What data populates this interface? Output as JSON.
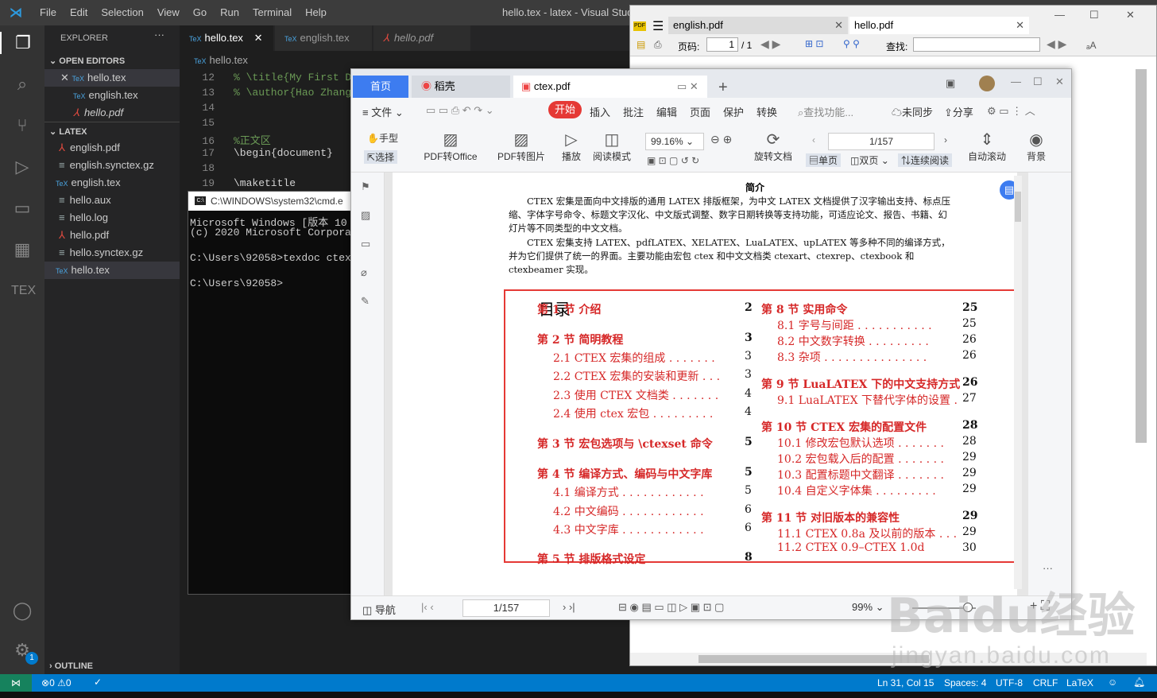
{
  "vscode": {
    "menu": [
      "File",
      "Edit",
      "Selection",
      "View",
      "Go",
      "Run",
      "Terminal",
      "Help"
    ],
    "window_title": "hello.tex - latex - Visual Studio",
    "explorer_label": "EXPLORER",
    "open_editors_label": "OPEN EDITORS",
    "open_editors": [
      "hello.tex",
      "english.tex",
      "hello.pdf"
    ],
    "latex_label": "LATEX",
    "files": [
      "english.pdf",
      "english.synctex.gz",
      "english.tex",
      "hello.aux",
      "hello.log",
      "hello.pdf",
      "hello.synctex.gz",
      "hello.tex"
    ],
    "outline_label": "OUTLINE",
    "tabs": [
      "hello.tex",
      "english.tex",
      "hello.pdf"
    ],
    "breadcrumb": "hello.tex",
    "code_lines": [
      {
        "n": "12",
        "t": "% \\title{My First D"
      },
      {
        "n": "13",
        "t": "% \\author{Hao Zhang"
      },
      {
        "n": "14",
        "t": ""
      },
      {
        "n": "15",
        "t": ""
      },
      {
        "n": "16",
        "t": "%正文区"
      },
      {
        "n": "17",
        "t": "\\begin{document}"
      },
      {
        "n": "18",
        "t": ""
      },
      {
        "n": "19",
        "t": "\\maketitle"
      }
    ],
    "status": {
      "errors": "0",
      "warnings": "0",
      "position": "Ln 31, Col 15",
      "spaces": "Spaces: 4",
      "encoding": "UTF-8",
      "eol": "CRLF",
      "lang": "LaTeX"
    },
    "badge": "1"
  },
  "cmd": {
    "title": "C:\\WINDOWS\\system32\\cmd.e",
    "lines": [
      "Microsoft Windows [版本 10",
      "(c) 2020 Microsoft Corpora",
      "",
      "C:\\Users\\92058>texdoc ctex",
      "",
      "C:\\Users\\92058>"
    ]
  },
  "sumatra": {
    "tabs": [
      "english.pdf",
      "hello.pdf"
    ],
    "page_label": "页码:",
    "page_value": "1",
    "page_total": "/ 1",
    "find_label": "查找:"
  },
  "wps": {
    "tabs": [
      "首页",
      "稻壳",
      "ctex.pdf"
    ],
    "menu": [
      "文件",
      "开始",
      "插入",
      "批注",
      "编辑",
      "页面",
      "保护",
      "转换"
    ],
    "search_placeholder": "查找功能...",
    "sync": "未同步",
    "share": "分享",
    "tools": {
      "hand": "手型",
      "select": "选择",
      "to_office": "PDF转Office",
      "to_image": "PDF转图片",
      "play": "播放",
      "read_mode": "阅读模式",
      "zoom": "99.16%",
      "rotate": "旋转文档",
      "page": "1/157",
      "single": "单页",
      "double": "双页",
      "continuous": "连续阅读",
      "autoscroll": "自动滚动",
      "background": "背景"
    },
    "bottom": {
      "nav": "导航",
      "page": "1/157",
      "zoom": "99%"
    },
    "doc": {
      "abstract_title": "简介",
      "para1": "CTEX 宏集是面向中文排版的通用 LATEX 排版框架，为中文 LATEX 文档提供了汉字输出支持、标点压缩、字体字号命令、标题文字汉化、中文版式调整、数字日期转换等支持功能，可适应论文、报告、书籍、幻灯片等不同类型的中文文档。",
      "para2": "CTEX 宏集支持 LATEX、pdfLATEX、XELATEX、LuaLATEX、upLATEX 等多种不同的编译方式，并为它们提供了统一的界面。主要功能由宏包 ctex 和中文文档类 ctexart、ctexrep、ctexbook 和 ctexbeamer 实现。",
      "toc_title": "目录",
      "toc_left": [
        {
          "label": "第 1 节  介绍",
          "page": "2",
          "sec": true
        },
        {
          "label": "第 2 节  简明教程",
          "page": "3",
          "sec": true
        },
        {
          "label": "2.1    CTEX 宏集的组成 . . . . . . .",
          "page": "3",
          "sec": false
        },
        {
          "label": "2.2    CTEX 宏集的安装和更新 . . .",
          "page": "3",
          "sec": false
        },
        {
          "label": "2.3    使用 CTEX 文档类 . . . . . . .",
          "page": "4",
          "sec": false
        },
        {
          "label": "2.4    使用 ctex 宏包 . . . . . . . . .",
          "page": "4",
          "sec": false
        },
        {
          "label": "第 3 节  宏包选项与 \\ctexset 命令",
          "page": "5",
          "sec": true
        },
        {
          "label": "第 4 节  编译方式、编码与中文字库",
          "page": "5",
          "sec": true
        },
        {
          "label": "4.1    编译方式 . . . . . . . . . . . .",
          "page": "5",
          "sec": false
        },
        {
          "label": "4.2    中文编码 . . . . . . . . . . . .",
          "page": "6",
          "sec": false
        },
        {
          "label": "4.3    中文字库 . . . . . . . . . . . .",
          "page": "6",
          "sec": false
        },
        {
          "label": "第 5 节  排版格式设定",
          "page": "8",
          "sec": true
        }
      ],
      "toc_right": [
        {
          "label": "第 8 节  实用命令",
          "page": "25",
          "sec": true
        },
        {
          "label": "8.1    字号与间距 . . . . . . . . . . .",
          "page": "25",
          "sec": false
        },
        {
          "label": "8.2    中文数字转换 . . . . . . . . .",
          "page": "26",
          "sec": false
        },
        {
          "label": "8.3    杂项 . . . . . . . . . . . . . . .",
          "page": "26",
          "sec": false
        },
        {
          "label": "第 9 节  LuaLATEX 下的中文支持方式",
          "page": "26",
          "sec": true
        },
        {
          "label": "9.1    LuaLATEX 下替代字体的设置 .",
          "page": "27",
          "sec": false
        },
        {
          "label": "第 10 节  CTEX 宏集的配置文件",
          "page": "28",
          "sec": true
        },
        {
          "label": "10.1  修改宏包默认选项 . . . . . . .",
          "page": "28",
          "sec": false
        },
        {
          "label": "10.2  宏包载入后的配置 . . . . . . .",
          "page": "29",
          "sec": false
        },
        {
          "label": "10.3  配置标题中文翻译 . . . . . . .",
          "page": "29",
          "sec": false
        },
        {
          "label": "10.4  自定义字体集 . . . . . . . . .",
          "page": "29",
          "sec": false
        },
        {
          "label": "第 11 节  对旧版本的兼容性",
          "page": "29",
          "sec": true
        },
        {
          "label": "11.1  CTEX 0.8a 及以前的版本 . . .",
          "page": "29",
          "sec": false
        },
        {
          "label": "11.2  CTEX 0.9–CTEX 1.0d",
          "page": "30",
          "sec": false
        }
      ]
    }
  },
  "watermark": {
    "brand": "Baidu经验",
    "url": "jingyan.baidu.com"
  }
}
